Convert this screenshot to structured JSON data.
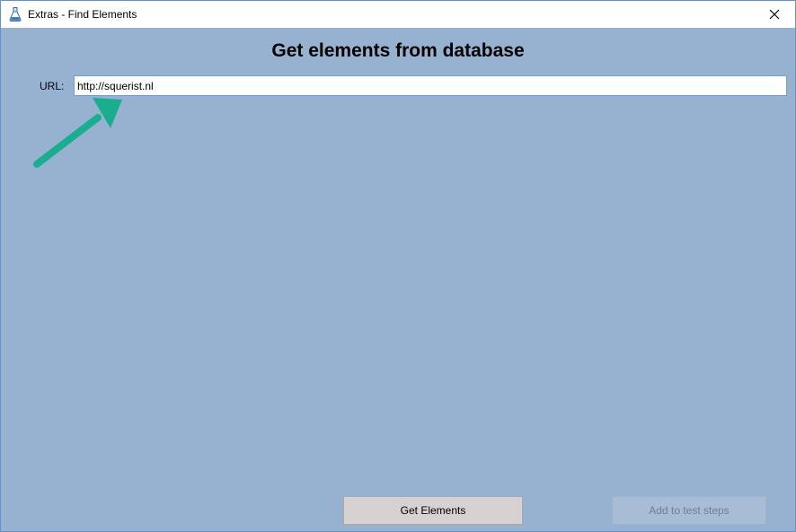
{
  "window": {
    "title": "Extras - Find Elements"
  },
  "main": {
    "heading": "Get elements from database",
    "url_label": "URL:",
    "url_value": "http://squerist.nl"
  },
  "buttons": {
    "get_elements": "Get Elements",
    "add_to_test_steps": "Add to test steps"
  },
  "icons": {
    "app": "flask-icon",
    "close": "close-icon",
    "annotation": "arrow-annotation-icon"
  },
  "colors": {
    "background": "#97b2d1",
    "arrow": "#1aae8f",
    "disabled_text": "#6d7f96"
  }
}
